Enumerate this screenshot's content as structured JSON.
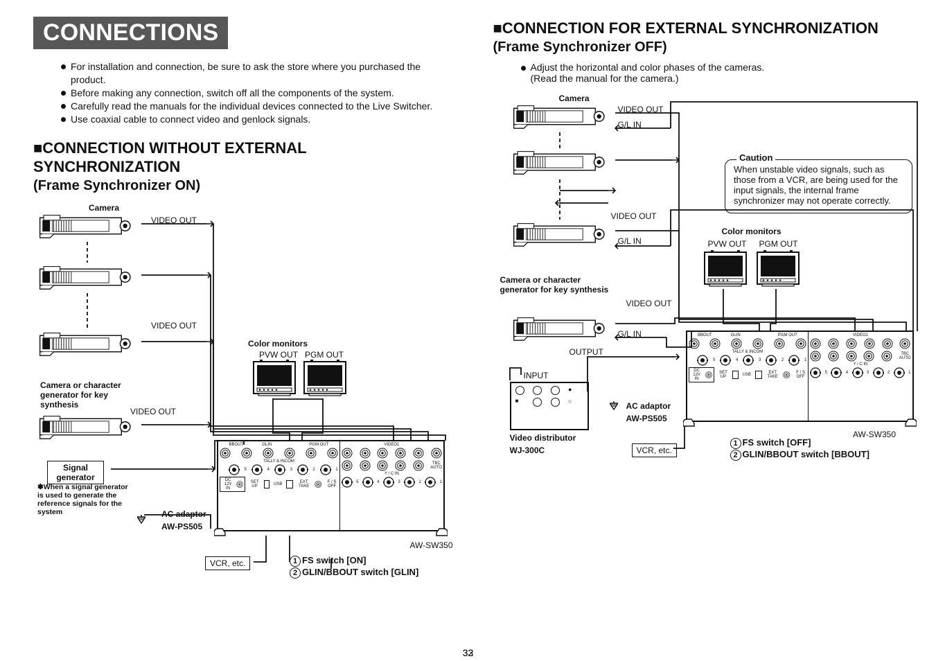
{
  "title_band": "CONNECTIONS",
  "intro": [
    "For installation and connection, be sure to ask the store where you purchased the product.",
    "Before making any connection, switch off all the components of the system.",
    "Carefully read the manuals for the individual devices connected to the Live Switcher.",
    "Use coaxial cable to connect video and genlock signals."
  ],
  "left_heading": "CONNECTION WITHOUT EXTERNAL SYNCHRONIZATION",
  "left_subheading": "(Frame Synchronizer ON)",
  "caution_title": "Caution",
  "caution_body": "When unstable video signals, such as those from a VCR, are being used for the input signals, the internal frame synchronizer may not operate correctly.",
  "camera_label": "Camera",
  "video_out": "VIDEO OUT",
  "gl_in": "G/L IN",
  "keygen_label": "Camera or character generator for key synthesis",
  "signal_generator": "Signal generator",
  "signal_generator_note": "✽When a signal generator is used to generate the reference signals for the system",
  "ac_adaptor": "AC adaptor",
  "ac_adaptor_model": "AW-PS505",
  "device_model": "AW-SW350",
  "vcr_etc": "VCR, etc.",
  "color_monitors": "Color monitors",
  "pvw_out": "PVW OUT",
  "pgm_out": "PGM OUT",
  "output": "OUTPUT",
  "input": "INPUT",
  "video_distributor": "Video distributor",
  "video_distributor_model": "WJ-300C",
  "switch_notes_left": [
    {
      "n": "1",
      "t": "FS switch [ON]"
    },
    {
      "n": "2",
      "t": "GLIN/BBOUT switch [GLIN]"
    }
  ],
  "switch_notes_right": [
    {
      "n": "1",
      "t": "FS switch [OFF]"
    },
    {
      "n": "2",
      "t": "GLIN/BBOUT switch [BBOUT]"
    }
  ],
  "right_heading": "CONNECTION FOR EXTERNAL SYNCHRONIZATION",
  "right_subheading": "(Frame Synchronizer OFF)",
  "right_lead": "Adjust the horizontal and color phases of the cameras.",
  "right_lead2": "(Read the manual for the camera.)",
  "page_left": "32",
  "page_right": "33",
  "panel_tiny": {
    "tally": "TALLY & INCOM",
    "bbout": "BBOUT",
    "glin": "GLIN",
    "usb": "USB",
    "setup": "SET UP",
    "pgmout": "PGM OUT",
    "dc": "DC 12V IN",
    "exttake": "EXT TAKE",
    "fsoff": "F / S OFF",
    "ycin": "Y / C  IN",
    "video1": "VIDEO1",
    "tbc": "TBC",
    "auto": "AUTO"
  }
}
